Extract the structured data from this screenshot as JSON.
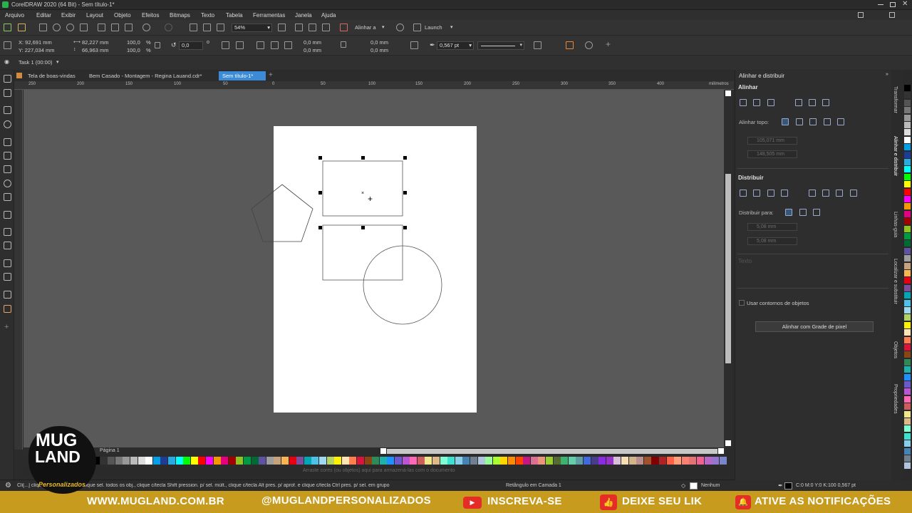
{
  "title": "CorelDRAW 2020 (64 Bit) - Sem título-1*",
  "menu": [
    "Arquivo",
    "Editar",
    "Exibir",
    "Layout",
    "Objeto",
    "Efeitos",
    "Bitmaps",
    "Texto",
    "Tabela",
    "Ferramentas",
    "Janela",
    "Ajuda"
  ],
  "toolbar": {
    "zoom": "54%",
    "align_label": "Alinhar a",
    "launch": "Launch"
  },
  "props": {
    "x": "X: 92,691 mm",
    "y": "Y: 227,034 mm",
    "w": "82,227 mm",
    "h": "66,963 mm",
    "sx": "100,0",
    "sy": "100,0",
    "pct": "%",
    "rot": "0,0",
    "c1a": "0,0 mm",
    "c1b": "0,0 mm",
    "c2a": "0,0 mm",
    "c2b": "0,0 mm",
    "outline": "0,567 pt"
  },
  "task": "Task 1 (00:00)",
  "tabs": [
    "Tela de boas-vindas",
    "Bem Casado - Montagem - Regina Lauand.cdr*",
    "Sem título-1*"
  ],
  "ruler_top": [
    "250",
    "200",
    "150",
    "100",
    "50",
    "0",
    "50",
    "100",
    "150",
    "200",
    "250",
    "300",
    "350",
    "400",
    "milímetros"
  ],
  "page_tab": "Página 1",
  "palette_hint": "Arraste cores (ou objetos) aqui para armazená-las com o documento",
  "status": {
    "hint": "Cli[...] clique sel.; a fer. duplo clique sel. todos os obj., clique c/tecla Shift pression. p/ sel. múlt., clique c/tecla Alt pres. p/ aprof. e clique c/tecla Ctrl pres. p/ sel. em grupo",
    "object": "Retângulo em Camada 1",
    "fill": "Nenhum",
    "outline": "C:0 M:0 Y:0 K:100  0,567 pt"
  },
  "panel": {
    "title": "Alinhar e distribuir",
    "align": "Alinhar",
    "align_to": "Alinhar topo:",
    "ax": "105,071 mm",
    "ay": "148,505 mm",
    "distribute": "Distribuir",
    "distribute_to": "Distribuir para:",
    "dh": "5,08 mm",
    "dv": "5,08 mm",
    "text_label": "Texto",
    "use_outlines": "Usar contornos de objetos",
    "grid_button": "Alinhar com Grade de pixel"
  },
  "side_tabs": [
    "Transformar",
    "Alinhar e distribuir",
    "Linhas-guia",
    "Localizar e substituir",
    "Objetos",
    "Propriedades"
  ],
  "banner": {
    "site": "WWW.MUGLAND.COM.BR",
    "insta": "@MUGLANDPERSONALIZADOS",
    "subscribe": "INSCREVA-SE",
    "like": "DEIXE SEU LIK",
    "notify": "ATIVE AS NOTIFICAÇÕES",
    "logo1": "MUG",
    "logo2": "LAND",
    "logo3": "Personalizados"
  },
  "colors": {
    "accent": "#3b8bd6",
    "banner": "#c79b1e",
    "canvas": "#595959"
  }
}
